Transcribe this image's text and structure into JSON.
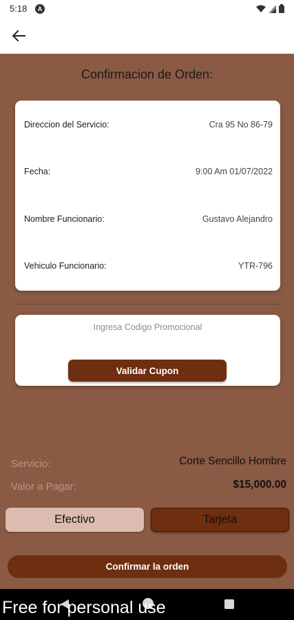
{
  "status_bar": {
    "time": "5:18",
    "app_icon_letter": "A",
    "icons": [
      "wifi-icon",
      "signal-icon",
      "battery-icon"
    ]
  },
  "app_bar": {
    "back_icon": "arrow-left-icon"
  },
  "page": {
    "title": "Confirmacion de Orden:"
  },
  "details": [
    {
      "label": "Direccion del Servicio:",
      "value": "Cra 95 No 86-79"
    },
    {
      "label": "Fecha:",
      "value": "9:00 Am 01/07/2022"
    },
    {
      "label": "Nombre Funcionario:",
      "value": "Gustavo Alejandro"
    },
    {
      "label": "Vehiculo Funcionario:",
      "value": "YTR-796"
    }
  ],
  "promo": {
    "placeholder": "Ingresa Codigo Promocional",
    "value": "",
    "validate_label": "Validar Cupon"
  },
  "summary": {
    "service_label": "Servicio:",
    "service_value": "Corte Sencillo Hombre",
    "amount_label": "Valor a Pagar:",
    "amount_value": "$15,000.00"
  },
  "payment": {
    "cash_label": "Efectivo",
    "card_label": "Tarjeta",
    "selected": "Tarjeta"
  },
  "confirm_label": "Confirmar la orden",
  "watermark": "Free for personal use",
  "colors": {
    "background": "#8a5a44",
    "primary_dark": "#6e2e10",
    "cash_button": "#dcbcb0",
    "muted_label": "#b99682"
  }
}
